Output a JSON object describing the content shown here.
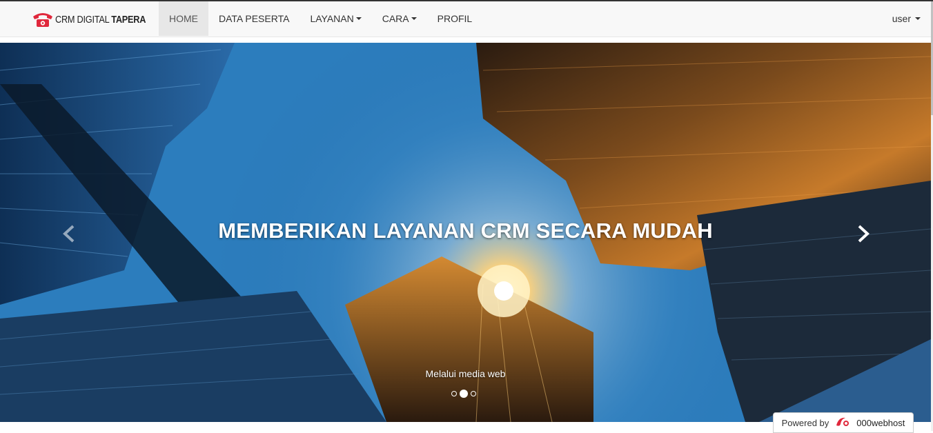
{
  "navbar": {
    "brand_prefix": "CRM DIGITAL",
    "brand_bold": "TAPERA",
    "items": [
      {
        "label": "HOME",
        "active": true,
        "dropdown": false
      },
      {
        "label": "DATA PESERTA",
        "active": false,
        "dropdown": false
      },
      {
        "label": "LAYANAN",
        "active": false,
        "dropdown": true
      },
      {
        "label": "CARA",
        "active": false,
        "dropdown": true
      },
      {
        "label": "PROFIL",
        "active": false,
        "dropdown": false
      }
    ],
    "user_label": "user"
  },
  "carousel": {
    "title": "MEMBERIKAN LAYANAN CRM SECARA MUDAH",
    "subtitle": "Melalui media web",
    "slide_count": 3,
    "active_slide": 2
  },
  "footer_badge": {
    "powered_label": "Powered by",
    "host_name": "000webhost"
  },
  "colors": {
    "brand_red": "#e0283c",
    "nav_bg": "#f8f8f8",
    "active_bg": "#e7e7e7"
  }
}
